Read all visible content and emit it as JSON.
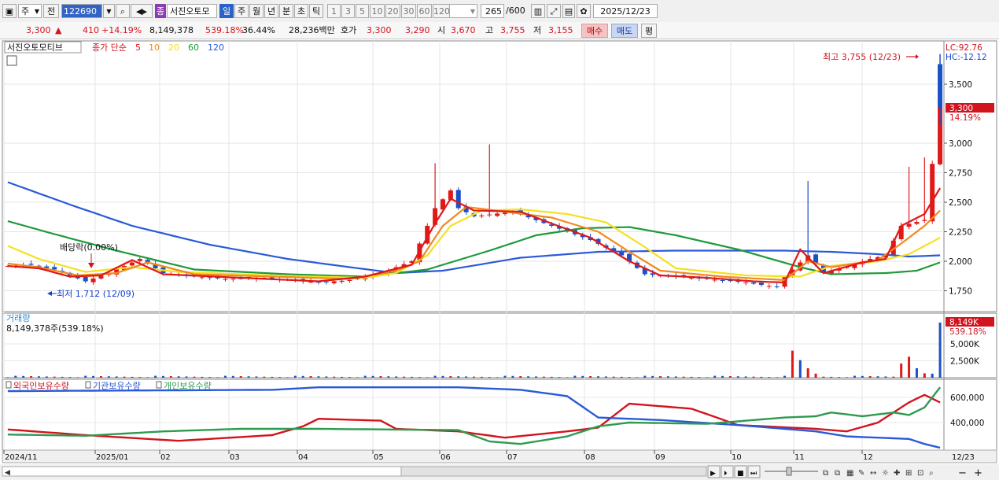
{
  "toolbar": {
    "period_mode": "주",
    "prev_label": "전",
    "code": "122690",
    "stock_badge": "종",
    "stock_name": "서진오토모",
    "periods": [
      "일",
      "주",
      "월",
      "년",
      "분",
      "초",
      "틱"
    ],
    "active_period": "일",
    "intervals": [
      "1",
      "3",
      "5",
      "10",
      "20",
      "30",
      "60",
      "120"
    ],
    "count": "265",
    "count_max": "/600",
    "date": "2025/12/23"
  },
  "quote": {
    "price": "3,300",
    "price_arrow": "▲",
    "change": "410",
    "change_pct": "+14.19%",
    "volume": "8,149,378",
    "volume_ratio": "539.18%",
    "turnover_rate": "36.44%",
    "amount": "28,236백만",
    "bid_label": "호가",
    "ask": "3,300",
    "bid": "3,290",
    "open_label": "시",
    "open": "3,670",
    "high_label": "고",
    "high": "3,755",
    "low_label": "저",
    "low": "3,155",
    "buy_label": "매수",
    "sell_label": "매도",
    "eval_label": "평"
  },
  "price_panel": {
    "stock_tab": "서진오토모티브",
    "ma_label": "종가 단순",
    "ma_periods": [
      "5",
      "10",
      "20",
      "60",
      "120"
    ],
    "ma_colors": [
      "#e01818",
      "#f08a20",
      "#f5e020",
      "#1e9a3a",
      "#2a5ad8"
    ],
    "lc": "LC:92.76",
    "hc": "HC:-12.12",
    "high_note": "최고 3,755 (12/23)",
    "low_note": "최저 1,712 (12/09)",
    "dividend_note": "배당락(0.00%)",
    "last_price_tag": "3,300",
    "last_pct_tag": "14.19%"
  },
  "volume_panel": {
    "title": "거래량",
    "summary": "8,149,378주(539.18%)",
    "last_tag": "8,149K",
    "last_pct": "539.18%"
  },
  "holdings_panel": {
    "legend": [
      "외국인보유수량",
      "기관보유수량",
      "개인보유수량"
    ],
    "colors": [
      "#d2141e",
      "#2a5ad8",
      "#2e9a50"
    ]
  },
  "x_axis_labels": [
    "2024/11",
    "2025/01",
    "02",
    "03",
    "04",
    "05",
    "06",
    "07",
    "08",
    "09",
    "10",
    "11",
    "12",
    "12/23"
  ],
  "bottom_bar": {
    "zoom_minus": "−",
    "zoom_plus": "+"
  },
  "chart_data": [
    {
      "type": "candlestick",
      "title": "서진오토모티브",
      "ylim": [
        1600,
        3800
      ],
      "y_ticks": [
        1750,
        2000,
        2250,
        2500,
        2750,
        3000,
        3500
      ],
      "y_tick_labels": [
        "1,750",
        "2,000",
        "2,250",
        "2,500",
        "2,750",
        "3,000",
        "3,500"
      ],
      "x_range": [
        "2024-11",
        "2025-12-23"
      ],
      "grid": true,
      "close_profile": [
        [
          0,
          1960
        ],
        [
          3,
          1970
        ],
        [
          6,
          1930
        ],
        [
          8,
          1880
        ],
        [
          10,
          1830
        ],
        [
          13,
          1900
        ],
        [
          17,
          2020
        ],
        [
          20,
          1900
        ],
        [
          24,
          1870
        ],
        [
          28,
          1850
        ],
        [
          33,
          1860
        ],
        [
          40,
          1820
        ],
        [
          44,
          1840
        ],
        [
          48,
          1900
        ],
        [
          52,
          2000
        ],
        [
          55,
          2450
        ],
        [
          57,
          2600
        ],
        [
          58,
          2450
        ],
        [
          60,
          2380
        ],
        [
          65,
          2420
        ],
        [
          70,
          2300
        ],
        [
          75,
          2180
        ],
        [
          79,
          2050
        ],
        [
          82,
          1890
        ],
        [
          86,
          1870
        ],
        [
          90,
          1850
        ],
        [
          95,
          1820
        ],
        [
          99,
          1780
        ],
        [
          100,
          1870
        ],
        [
          103,
          2050
        ],
        [
          105,
          1900
        ],
        [
          108,
          1950
        ],
        [
          111,
          2020
        ],
        [
          113,
          2050
        ],
        [
          115,
          2300
        ],
        [
          118,
          2350
        ],
        [
          120,
          3300
        ]
      ],
      "ma5_profile": [
        [
          0,
          1960
        ],
        [
          4,
          1940
        ],
        [
          8,
          1870
        ],
        [
          12,
          1880
        ],
        [
          16,
          2010
        ],
        [
          20,
          1890
        ],
        [
          30,
          1860
        ],
        [
          40,
          1830
        ],
        [
          46,
          1870
        ],
        [
          52,
          1970
        ],
        [
          55,
          2320
        ],
        [
          57,
          2530
        ],
        [
          60,
          2430
        ],
        [
          66,
          2420
        ],
        [
          70,
          2320
        ],
        [
          75,
          2200
        ],
        [
          80,
          2000
        ],
        [
          84,
          1880
        ],
        [
          90,
          1860
        ],
        [
          96,
          1830
        ],
        [
          100,
          1820
        ],
        [
          102,
          2100
        ],
        [
          105,
          1900
        ],
        [
          110,
          1990
        ],
        [
          113,
          2020
        ],
        [
          115,
          2300
        ],
        [
          118,
          2400
        ],
        [
          120,
          2620
        ]
      ],
      "ma10_profile": [
        [
          0,
          1980
        ],
        [
          4,
          1950
        ],
        [
          9,
          1880
        ],
        [
          14,
          1900
        ],
        [
          18,
          1990
        ],
        [
          24,
          1890
        ],
        [
          34,
          1870
        ],
        [
          44,
          1850
        ],
        [
          50,
          1920
        ],
        [
          53,
          2000
        ],
        [
          56,
          2300
        ],
        [
          59,
          2460
        ],
        [
          64,
          2420
        ],
        [
          70,
          2370
        ],
        [
          76,
          2250
        ],
        [
          80,
          2080
        ],
        [
          84,
          1920
        ],
        [
          92,
          1870
        ],
        [
          100,
          1840
        ],
        [
          103,
          2000
        ],
        [
          106,
          1950
        ],
        [
          112,
          2010
        ],
        [
          115,
          2150
        ],
        [
          118,
          2300
        ],
        [
          120,
          2430
        ]
      ],
      "ma20_profile": [
        [
          0,
          2130
        ],
        [
          4,
          2020
        ],
        [
          10,
          1910
        ],
        [
          16,
          1950
        ],
        [
          22,
          1910
        ],
        [
          34,
          1880
        ],
        [
          46,
          1860
        ],
        [
          50,
          1900
        ],
        [
          54,
          2050
        ],
        [
          57,
          2300
        ],
        [
          61,
          2430
        ],
        [
          66,
          2440
        ],
        [
          72,
          2400
        ],
        [
          77,
          2330
        ],
        [
          82,
          2120
        ],
        [
          86,
          1940
        ],
        [
          95,
          1880
        ],
        [
          102,
          1870
        ],
        [
          106,
          1960
        ],
        [
          112,
          2000
        ],
        [
          116,
          2060
        ],
        [
          120,
          2200
        ]
      ],
      "ma60_profile": [
        [
          0,
          2340
        ],
        [
          6,
          2230
        ],
        [
          14,
          2090
        ],
        [
          24,
          1930
        ],
        [
          36,
          1890
        ],
        [
          46,
          1870
        ],
        [
          54,
          1930
        ],
        [
          62,
          2090
        ],
        [
          68,
          2220
        ],
        [
          74,
          2280
        ],
        [
          80,
          2290
        ],
        [
          86,
          2220
        ],
        [
          94,
          2100
        ],
        [
          102,
          1950
        ],
        [
          106,
          1890
        ],
        [
          113,
          1900
        ],
        [
          117,
          1920
        ],
        [
          120,
          1990
        ]
      ],
      "ma120_profile": [
        [
          0,
          2670
        ],
        [
          8,
          2480
        ],
        [
          16,
          2300
        ],
        [
          26,
          2140
        ],
        [
          36,
          2020
        ],
        [
          44,
          1950
        ],
        [
          50,
          1900
        ],
        [
          56,
          1920
        ],
        [
          66,
          2030
        ],
        [
          76,
          2080
        ],
        [
          86,
          2090
        ],
        [
          100,
          2090
        ],
        [
          106,
          2080
        ],
        [
          112,
          2060
        ],
        [
          116,
          2040
        ],
        [
          120,
          2050
        ]
      ]
    },
    {
      "type": "bar",
      "title": "거래량",
      "y_ticks": [
        2500,
        5000
      ],
      "y_tick_labels": [
        "2,500K",
        "5,000K"
      ],
      "ylim": [
        0,
        8500
      ],
      "unit": "K",
      "spikes": [
        [
          101,
          4000,
          "red"
        ],
        [
          102,
          2600,
          "blue"
        ],
        [
          103,
          1400,
          "red"
        ],
        [
          104,
          600,
          "red"
        ],
        [
          115,
          2100,
          "red"
        ],
        [
          116,
          3100,
          "red"
        ],
        [
          117,
          1400,
          "blue"
        ],
        [
          118,
          650,
          "red"
        ],
        [
          119,
          600,
          "blue"
        ],
        [
          120,
          8149,
          "blue"
        ]
      ]
    },
    {
      "type": "line",
      "title": "보유수량",
      "series": [
        {
          "name": "외국인보유수량",
          "values": [
            [
              0,
              345000
            ],
            [
              10,
              300000
            ],
            [
              22,
              255000
            ],
            [
              34,
              300000
            ],
            [
              38,
              370000
            ],
            [
              40,
              430000
            ],
            [
              48,
              415000
            ],
            [
              50,
              350000
            ],
            [
              58,
              330000
            ],
            [
              64,
              280000
            ],
            [
              72,
              330000
            ],
            [
              76,
              360000
            ],
            [
              80,
              550000
            ],
            [
              88,
              510000
            ],
            [
              94,
              380000
            ],
            [
              104,
              350000
            ],
            [
              108,
              330000
            ],
            [
              112,
              400000
            ],
            [
              116,
              560000
            ],
            [
              118,
              620000
            ],
            [
              120,
              560000
            ]
          ]
        },
        {
          "name": "기관보유수량",
          "values": [
            [
              0,
              650000
            ],
            [
              34,
              660000
            ],
            [
              40,
              680000
            ],
            [
              58,
              680000
            ],
            [
              66,
              660000
            ],
            [
              72,
              610000
            ],
            [
              76,
              440000
            ],
            [
              84,
              420000
            ],
            [
              94,
              380000
            ],
            [
              104,
              330000
            ],
            [
              108,
              290000
            ],
            [
              116,
              270000
            ],
            [
              118,
              230000
            ],
            [
              120,
              200000
            ]
          ]
        },
        {
          "name": "개인보유수량",
          "values": [
            [
              0,
              305000
            ],
            [
              10,
              295000
            ],
            [
              20,
              330000
            ],
            [
              30,
              350000
            ],
            [
              40,
              350000
            ],
            [
              58,
              340000
            ],
            [
              62,
              250000
            ],
            [
              66,
              230000
            ],
            [
              72,
              290000
            ],
            [
              76,
              370000
            ],
            [
              80,
              400000
            ],
            [
              90,
              390000
            ],
            [
              100,
              440000
            ],
            [
              104,
              450000
            ],
            [
              106,
              480000
            ],
            [
              110,
              450000
            ],
            [
              114,
              480000
            ],
            [
              116,
              460000
            ],
            [
              118,
              520000
            ],
            [
              120,
              680000
            ]
          ]
        }
      ],
      "y_ticks": [
        400000,
        600000
      ],
      "y_tick_labels": [
        "400,000",
        "600,000"
      ],
      "ylim": [
        200000,
        720000
      ]
    }
  ]
}
